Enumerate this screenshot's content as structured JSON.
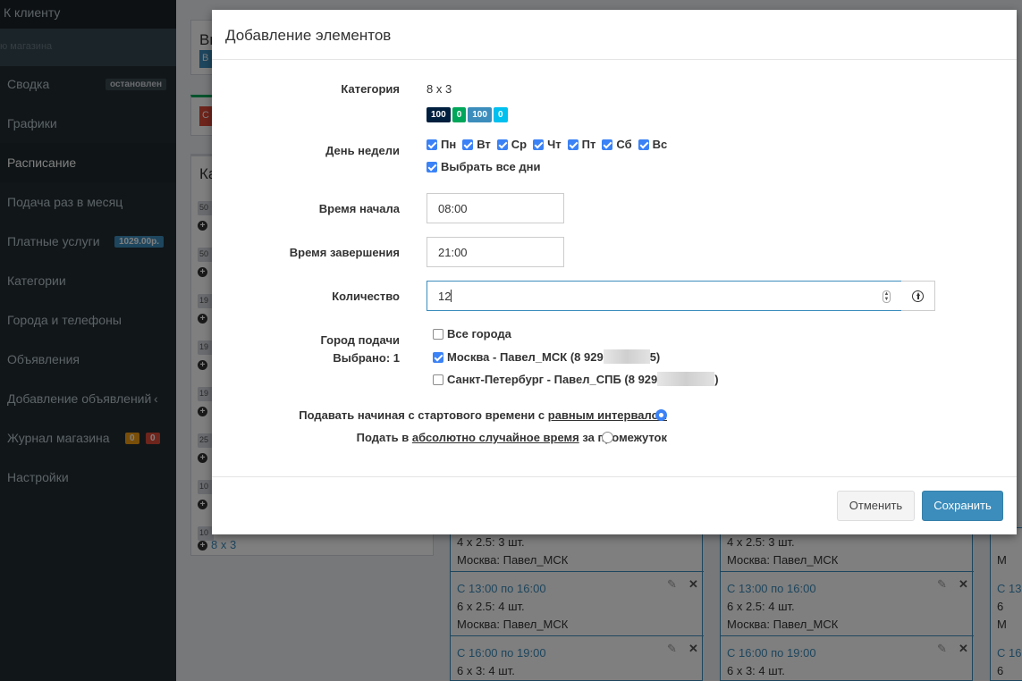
{
  "sidebar": {
    "top_link": "К клиенту",
    "search_placeholder": "ю магазина",
    "items": [
      {
        "label": "Сводка",
        "badge": "остановлен"
      },
      {
        "label": "Графики"
      },
      {
        "label": "Расписание"
      },
      {
        "label": "Подача раз в месяц"
      },
      {
        "label": "Платные услуги",
        "badge": "1029.00р."
      },
      {
        "label": "Категории"
      },
      {
        "label": "Города и телефоны"
      },
      {
        "label": "Объявления"
      },
      {
        "label": "Добавление объявлений"
      },
      {
        "label": "Журнал магазина",
        "badge_orange": "0",
        "badge_red": "0"
      },
      {
        "label": "Настройки"
      }
    ]
  },
  "background": {
    "panel1_title": "Вы",
    "panel1_btn": "В",
    "panel2_btn": "С",
    "panel3_title": "Ка",
    "rows": [
      "50",
      "50",
      "19",
      "19",
      "19",
      "25",
      "10",
      "10"
    ],
    "last_link": "8 x 3",
    "schedule": [
      {
        "size": "4 x 2.5: 3 шт.",
        "city": "Москва: Павел_МСК"
      },
      {
        "time": "С 13:00 по 16:00",
        "size": "6 x 2.5: 4 шт.",
        "city": "Москва: Павел_МСК"
      },
      {
        "time": "С 16:00 по 19:00",
        "size": "6 x 3: 4 шт."
      }
    ],
    "col3_fragments": {
      "m": "М",
      "c1": "С 13",
      "six1": "6",
      "m2": "М",
      "c2": "С 16",
      "six2": "6"
    }
  },
  "modal": {
    "title": "Добавление элементов",
    "category_label": "Категория",
    "category_value": "8 x 3",
    "tags": [
      {
        "text": "100",
        "color": "#001f3f"
      },
      {
        "text": "0",
        "color": "#00a65a"
      },
      {
        "text": "100",
        "color": "#3c8dbc"
      },
      {
        "text": "0",
        "color": "#00c0ef"
      }
    ],
    "weekday_label": "День недели",
    "days": [
      "Пн",
      "Вт",
      "Ср",
      "Чт",
      "Пт",
      "Сб",
      "Вс"
    ],
    "select_all_days": "Выбрать все дни",
    "start_time_label": "Время начала",
    "start_time": "08:00",
    "end_time_label": "Время завершения",
    "end_time": "21:00",
    "quantity_label": "Количество",
    "quantity": "12",
    "city_label": "Город подачи",
    "selected_label": "Выбрано: 1",
    "cities": [
      {
        "label": "Все города",
        "checked": false
      },
      {
        "label_start": "Москва - Павел_МСК (8 929",
        "label_end": "5)",
        "checked": true
      },
      {
        "label_start": "Санкт-Петербург - Павел_СПБ (8 929",
        "label_end": ")",
        "checked": false
      }
    ],
    "option1_text": "Подавать начиная с стартового времени с",
    "option1_link": "равным интервалом",
    "option2_text": "Подать в",
    "option2_link": "абсолютно случайное время",
    "option2_tail": "за промежуток",
    "cancel": "Отменить",
    "save": "Сохранить"
  }
}
